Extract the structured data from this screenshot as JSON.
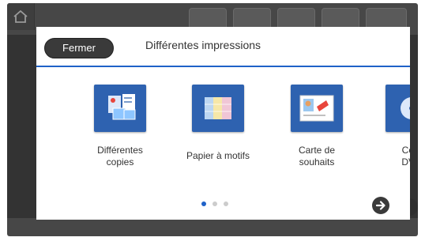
{
  "dialog": {
    "close_label": "Fermer",
    "title": "Différentes impressions"
  },
  "items": [
    {
      "label_line1": "Différentes",
      "label_line2": "copies",
      "icon": "copies-icon"
    },
    {
      "label_line1": "Papier à motifs",
      "label_line2": "",
      "icon": "patterned-paper-icon"
    },
    {
      "label_line1": "Carte de",
      "label_line2": "souhaits",
      "icon": "greeting-card-icon"
    },
    {
      "label_line1": "Copi",
      "label_line2": "DVD",
      "icon": "dvd-copy-icon"
    }
  ],
  "pagination": {
    "total": 3,
    "active": 1
  },
  "colors": {
    "accent": "#1f62c8",
    "tile": "#2e62b0",
    "dot_active": "#1f62c8",
    "dot_inactive": "#cccccc"
  }
}
